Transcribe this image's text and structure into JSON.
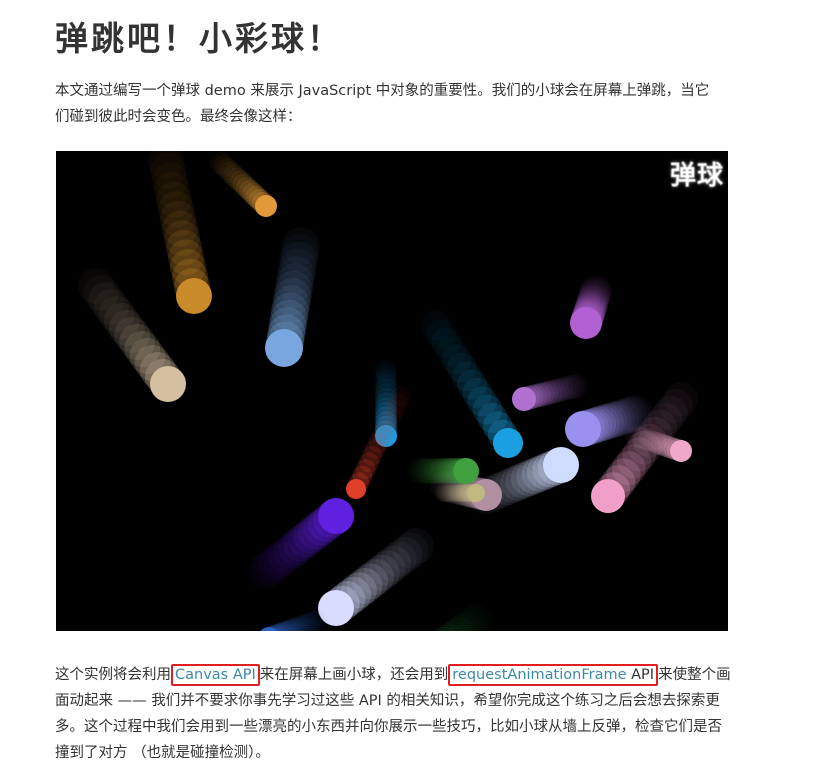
{
  "article": {
    "title": "弹跳吧！小彩球！",
    "intro": "本文通过编写一个弹球 demo 来展示 JavaScript 中对象的重要性。我们的小球会在屏幕上弹跳，当它们碰到彼此时会变色。最终会像这样：",
    "demo": {
      "watermark": "弹球",
      "background": "#000000",
      "balls": [
        {
          "color": "#c98a2a",
          "trail": [
            [
              110,
              10
            ],
            [
              138,
              145
            ]
          ],
          "r": 18
        },
        {
          "color": "#e09a3a",
          "trail": [
            [
              165,
              12
            ],
            [
              210,
              55
            ]
          ],
          "r": 11
        },
        {
          "color": "#d4bfa0",
          "trail": [
            [
              40,
              135
            ],
            [
              112,
              233
            ]
          ],
          "r": 18
        },
        {
          "color": "#7aa6e0",
          "trail": [
            [
              245,
              95
            ],
            [
              228,
              197
            ]
          ],
          "r": 19
        },
        {
          "color": "#1e9ae0",
          "trail": [
            [
              330,
              220
            ],
            [
              330,
              285
            ]
          ],
          "r": 11
        },
        {
          "color": "#e0402a",
          "trail": [
            [
              345,
              245
            ],
            [
              300,
              338
            ]
          ],
          "r": 10
        },
        {
          "color": "#6020e0",
          "trail": [
            [
              210,
              420
            ],
            [
              280,
              365
            ]
          ],
          "r": 18
        },
        {
          "color": "#1aa0e0",
          "trail": [
            [
              380,
              175
            ],
            [
              452,
              292
            ]
          ],
          "r": 15
        },
        {
          "color": "#b060d0",
          "trail": [
            [
              540,
              140
            ],
            [
              530,
              172
            ]
          ],
          "r": 16
        },
        {
          "color": "#b070d0",
          "trail": [
            [
              520,
              235
            ],
            [
              468,
              248
            ]
          ],
          "r": 12
        },
        {
          "color": "#9a90f0",
          "trail": [
            [
              580,
              262
            ],
            [
              527,
              278
            ]
          ],
          "r": 18
        },
        {
          "color": "#f0a0c8",
          "trail": [
            [
              625,
              248
            ],
            [
              552,
              345
            ]
          ],
          "r": 17
        },
        {
          "color": "#f0a8c8",
          "trail": [
            [
              580,
              285
            ],
            [
              625,
              300
            ]
          ],
          "r": 11
        },
        {
          "color": "#d0dcff",
          "trail": [
            [
              430,
              345
            ],
            [
              505,
              314
            ]
          ],
          "r": 18
        },
        {
          "color": "#b090a0",
          "trail": [
            [
              390,
              335
            ],
            [
              430,
              344
            ]
          ],
          "r": 16
        },
        {
          "color": "#40a040",
          "trail": [
            [
              365,
              320
            ],
            [
              410,
              320
            ]
          ],
          "r": 13
        },
        {
          "color": "#c0b880",
          "trail": [
            [
              388,
              342
            ],
            [
              420,
              342
            ]
          ],
          "r": 9
        },
        {
          "color": "#d8dcff",
          "trail": [
            [
              360,
              395
            ],
            [
              280,
              457
            ]
          ],
          "r": 18
        },
        {
          "color": "#3060c0",
          "trail": [
            [
              260,
              470
            ],
            [
              213,
              487
            ]
          ],
          "r": 11
        },
        {
          "color": "#206030",
          "trail": [
            [
              420,
              470
            ],
            [
              358,
              516
            ]
          ],
          "r": 17
        },
        {
          "color": "#f08040",
          "trail": [
            [
              350,
              610
            ],
            [
              437,
              537
            ]
          ],
          "r": 17
        },
        {
          "color": "#f07838",
          "trail": [
            [
              350,
              640
            ],
            [
              298,
              588
            ]
          ],
          "r": 10
        },
        {
          "color": "#3a60c0",
          "trail": [
            [
              200,
              640
            ],
            [
              200,
              587
            ]
          ],
          "r": 16
        },
        {
          "color": "#9080d0",
          "trail": [
            [
              540,
              520
            ],
            [
              604,
              564
            ]
          ],
          "r": 17
        },
        {
          "color": "#e8e830",
          "trail": [
            [
              695,
              540
            ],
            [
              687,
              563
            ]
          ],
          "r": 15
        },
        {
          "color": "#e0e040",
          "trail": [
            [
              700,
              530
            ],
            [
              692,
              497
            ]
          ],
          "r": 11
        }
      ]
    },
    "paragraph": {
      "part1": "这个实例将会利用",
      "link1": "Canvas API",
      "part2": "来在屏幕上画小球，还会用到",
      "link2": "requestAnimationFrame",
      "link2_suffix": " API",
      "part3": "来使整个画面动起来 —— 我们并不要求你事先学习过这些 API 的相关知识，希望你完成这个练习之后会想去探索更多。这个过程中我们会用到一些漂亮的小东西并向你展示一些技巧，比如小球从墙上反弹，检查它们是否撞到了对方 （也就是碰撞检测）。"
    },
    "colors": {
      "text": "#333333",
      "link": "#3b8ba7",
      "highlight_border": "#e02020"
    }
  }
}
